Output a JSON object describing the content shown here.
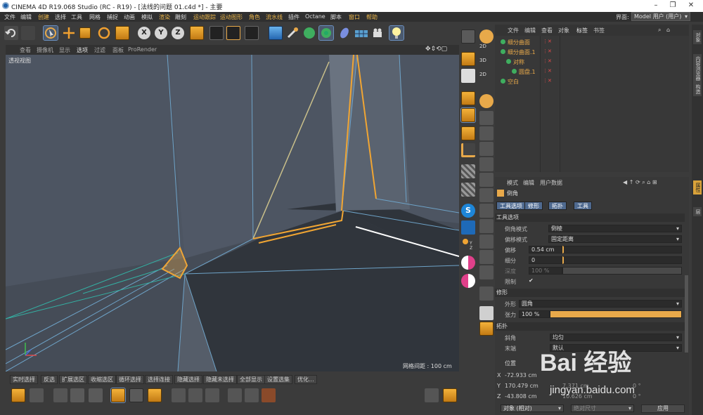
{
  "window": {
    "title": "CINEMA 4D R19.068 Studio (RC - R19) - [法线的问题 01.c4d *] - 主要"
  },
  "menubar": {
    "items": [
      {
        "label": "文件",
        "hl": false
      },
      {
        "label": "编辑",
        "hl": false
      },
      {
        "label": "创建",
        "hl": true
      },
      {
        "label": "选择",
        "hl": false
      },
      {
        "label": "工具",
        "hl": false
      },
      {
        "label": "网格",
        "hl": false
      },
      {
        "label": "捕捉",
        "hl": false
      },
      {
        "label": "动画",
        "hl": false
      },
      {
        "label": "模拟",
        "hl": false
      },
      {
        "label": "渲染",
        "hl": true
      },
      {
        "label": "雕刻",
        "hl": false
      },
      {
        "label": "运动跟踪",
        "hl": true
      },
      {
        "label": "运动图形",
        "hl": true
      },
      {
        "label": "角色",
        "hl": true
      },
      {
        "label": "流水线",
        "hl": true
      },
      {
        "label": "插件",
        "hl": false
      },
      {
        "label": "Octane",
        "hl": false
      },
      {
        "label": "脚本",
        "hl": false
      },
      {
        "label": "窗口",
        "hl": true
      },
      {
        "label": "帮助",
        "hl": true
      }
    ],
    "layout_label": "界面:",
    "layout_value": "Model 用户 (用户)"
  },
  "viewport": {
    "menu": [
      "查看",
      "摄像机",
      "显示",
      "选项",
      "过滤",
      "面板",
      "ProRender"
    ],
    "active_menu": "选项",
    "label": "透视视图",
    "grid": "网格间距 : 100 cm"
  },
  "bottom_tabs": [
    "实时选择",
    "反选",
    "扩展选区",
    "收缩选区",
    "循环选择",
    "选择连接",
    "隐藏选择",
    "隐藏未选择",
    "全部显示",
    "设置选集",
    "优化..."
  ],
  "object_manager": {
    "menu": [
      "文件",
      "编辑",
      "查看",
      "对象",
      "标签",
      "书签"
    ],
    "active_menu": "标签",
    "objects": [
      {
        "name": "细分曲面",
        "color": "#e8a94a",
        "indent": 0
      },
      {
        "name": "细分曲面.1",
        "color": "#e8a94a",
        "indent": 0
      },
      {
        "name": "对称",
        "color": "#e8a94a",
        "indent": 1
      },
      {
        "name": "圆盘.1",
        "color": "#e8a94a",
        "indent": 2
      },
      {
        "name": "空白",
        "color": "#e8a94a",
        "indent": 0
      }
    ]
  },
  "right_tabs": [
    "对象",
    "内容浏览器",
    "构造",
    "属性",
    "层"
  ],
  "attributes": {
    "menu": [
      "模式",
      "编辑",
      "用户数据"
    ],
    "tool_name": "倒角",
    "tabs": [
      "工具选项",
      "修形",
      "拓扑",
      "工具"
    ],
    "section_tool": "工具选项",
    "bevel_mode_label": "倒角模式",
    "bevel_mode": "倒棱",
    "offset_mode_label": "偏移模式",
    "offset_mode": "固定距离",
    "offset_label": "偏移",
    "offset": "0.54 cm",
    "subdiv_label": "细分",
    "subdiv": "0",
    "depth_label": "深度",
    "depth": "100 %",
    "limit_label": "限制",
    "section_shape": "修形",
    "shape_label": "外形",
    "shape": "圆角",
    "tension_label": "张力",
    "tension": "100 %",
    "tension_fraction": 1.0,
    "section_topo": "拓扑",
    "miter_label": "斜角",
    "miter": "均匀",
    "end_label": "末端",
    "end": "默认"
  },
  "coordinates": {
    "header": "位置",
    "x": "-72.933 cm",
    "y": "170.479 cm",
    "z": "-43.808 cm",
    "size_y": "7.371 cm",
    "size_z": "10.626 cm",
    "rot_b": "0 °",
    "rot_p": "0 °",
    "mode": "对象 (相对)",
    "size_mode": "绝对尺寸",
    "apply": "应用"
  },
  "watermark": {
    "main": "Bai 经验",
    "url": "jingyan.baidu.com"
  }
}
